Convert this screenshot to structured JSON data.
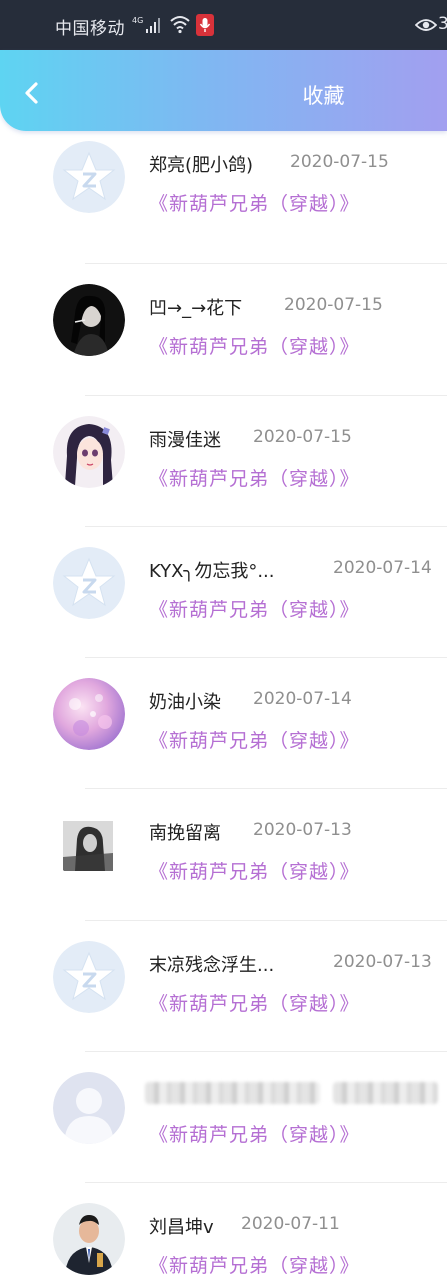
{
  "status_bar": {
    "carrier": "中国移动",
    "network": "4G",
    "right_text": "3",
    "icons": [
      "signal-icon",
      "wifi-icon",
      "microphone-icon",
      "eye-icon"
    ],
    "mic_color": "#d8323a"
  },
  "header": {
    "title": "收藏",
    "back_icon": "chevron-left-icon",
    "gradient": [
      "#5ed4f2",
      "#a29ff0"
    ]
  },
  "favorites": [
    {
      "user": "郑亮(肥小鸽)",
      "date": "2020-07-15",
      "work": "《新葫芦兄弟（穿越）》",
      "avatar": "qq-default-avatar"
    },
    {
      "user": "凹→_→花下",
      "date": "2020-07-15",
      "work": "《新葫芦兄弟（穿越）》",
      "avatar": "dark-photo-avatar"
    },
    {
      "user": "雨漫佳迷",
      "date": "2020-07-15",
      "work": "《新葫芦兄弟（穿越）》",
      "avatar": "anime-girl-avatar"
    },
    {
      "user": "KYX╮勿忘我°...",
      "date": "2020-07-14",
      "work": "《新葫芦兄弟（穿越）》",
      "avatar": "qq-default-avatar"
    },
    {
      "user": "奶油小染",
      "date": "2020-07-14",
      "work": "《新葫芦兄弟（穿越）》",
      "avatar": "purple-flower-avatar"
    },
    {
      "user": "南挽留离",
      "date": "2020-07-13",
      "work": "《新葫芦兄弟（穿越）》",
      "avatar": "bw-photo-avatar"
    },
    {
      "user": "末凉残念浮生...",
      "date": "2020-07-13",
      "work": "《新葫芦兄弟（穿越）》",
      "avatar": "qq-default-avatar"
    },
    {
      "user": "",
      "date": "",
      "work": "《新葫芦兄弟（穿越）》",
      "avatar": "default-person-avatar"
    },
    {
      "user": "刘昌坤v",
      "date": "2020-07-11",
      "work": "《新葫芦兄弟（穿越）》",
      "avatar": "man-photo-avatar"
    }
  ],
  "colors": {
    "work_title": "#b56fd3",
    "date": "#8f8f8f",
    "name": "#222222"
  }
}
